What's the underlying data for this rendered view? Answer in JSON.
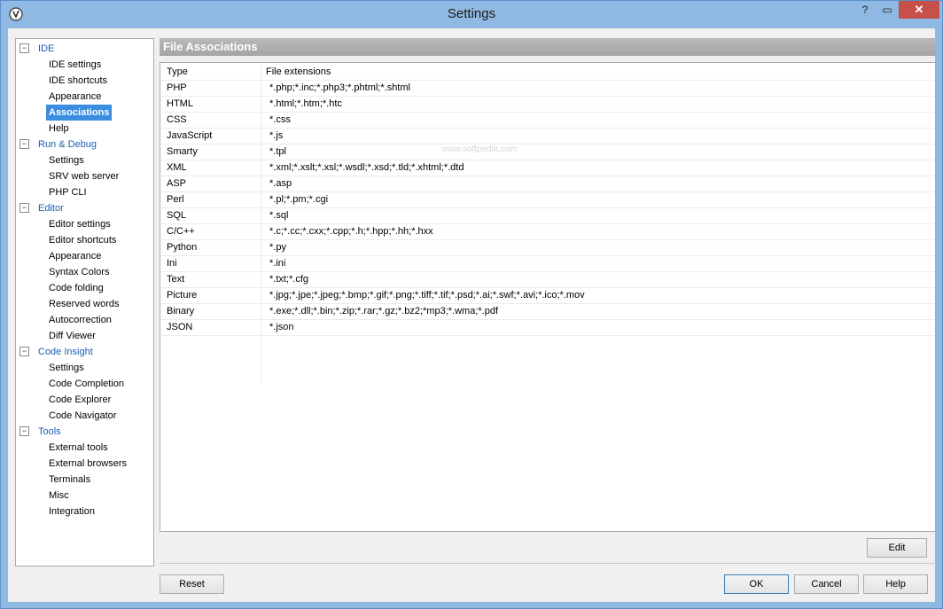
{
  "window": {
    "title": "Settings"
  },
  "titlebar_buttons": {
    "help": "?",
    "restore": "▭",
    "close": "✕"
  },
  "tree": [
    {
      "label": "IDE",
      "type": "group",
      "toggle": "−"
    },
    {
      "label": "IDE settings",
      "type": "leaf"
    },
    {
      "label": "IDE shortcuts",
      "type": "leaf"
    },
    {
      "label": "Appearance",
      "type": "leaf"
    },
    {
      "label": "Associations",
      "type": "leaf",
      "selected": true
    },
    {
      "label": "Help",
      "type": "leaf"
    },
    {
      "label": "Run & Debug",
      "type": "group",
      "toggle": "−"
    },
    {
      "label": "Settings",
      "type": "leaf"
    },
    {
      "label": "SRV web server",
      "type": "leaf"
    },
    {
      "label": "PHP CLI",
      "type": "leaf"
    },
    {
      "label": "Editor",
      "type": "group",
      "toggle": "−"
    },
    {
      "label": "Editor settings",
      "type": "leaf"
    },
    {
      "label": "Editor shortcuts",
      "type": "leaf"
    },
    {
      "label": "Appearance",
      "type": "leaf"
    },
    {
      "label": "Syntax Colors",
      "type": "leaf"
    },
    {
      "label": "Code folding",
      "type": "leaf"
    },
    {
      "label": "Reserved words",
      "type": "leaf"
    },
    {
      "label": "Autocorrection",
      "type": "leaf"
    },
    {
      "label": "Diff Viewer",
      "type": "leaf"
    },
    {
      "label": "Code Insight",
      "type": "group",
      "toggle": "−"
    },
    {
      "label": "Settings",
      "type": "leaf"
    },
    {
      "label": "Code Completion",
      "type": "leaf"
    },
    {
      "label": "Code Explorer",
      "type": "leaf"
    },
    {
      "label": "Code Navigator",
      "type": "leaf"
    },
    {
      "label": "Tools",
      "type": "group",
      "toggle": "−"
    },
    {
      "label": "External tools",
      "type": "leaf"
    },
    {
      "label": "External browsers",
      "type": "leaf"
    },
    {
      "label": "Terminals",
      "type": "leaf"
    },
    {
      "label": "Misc",
      "type": "leaf"
    },
    {
      "label": "Integration",
      "type": "leaf"
    }
  ],
  "panel": {
    "title": "File Associations",
    "columns": [
      "Type",
      "File extensions"
    ],
    "rows": [
      [
        "PHP",
        "*.php;*.inc;*.php3;*.phtml;*.shtml"
      ],
      [
        "HTML",
        "*.html;*.htm;*.htc"
      ],
      [
        "CSS",
        "*.css"
      ],
      [
        "JavaScript",
        "*.js"
      ],
      [
        "Smarty",
        "*.tpl"
      ],
      [
        "XML",
        "*.xml;*.xslt;*.xsl;*.wsdl;*.xsd;*.tld;*.xhtml;*.dtd"
      ],
      [
        "ASP",
        "*.asp"
      ],
      [
        "Perl",
        "*.pl;*.pm;*.cgi"
      ],
      [
        "SQL",
        "*.sql"
      ],
      [
        "C/C++",
        "*.c;*.cc;*.cxx;*.cpp;*.h;*.hpp;*.hh;*.hxx"
      ],
      [
        "Python",
        "*.py"
      ],
      [
        "Ini",
        "*.ini"
      ],
      [
        "Text",
        "*.txt;*.cfg"
      ],
      [
        "Picture",
        "*.jpg;*.jpe;*.jpeg;*.bmp;*.gif;*.png;*.tiff;*.tif;*.psd;*.ai;*.swf;*.avi;*.ico;*.mov"
      ],
      [
        "Binary",
        "*.exe;*.dll;*.bin;*.zip;*.rar;*.gz;*.bz2;*mp3;*.wma;*.pdf"
      ],
      [
        "JSON",
        "*.json"
      ]
    ],
    "watermark": "www.softpedia.com"
  },
  "buttons": {
    "edit": "Edit",
    "reset": "Reset",
    "ok": "OK",
    "cancel": "Cancel",
    "help": "Help"
  }
}
